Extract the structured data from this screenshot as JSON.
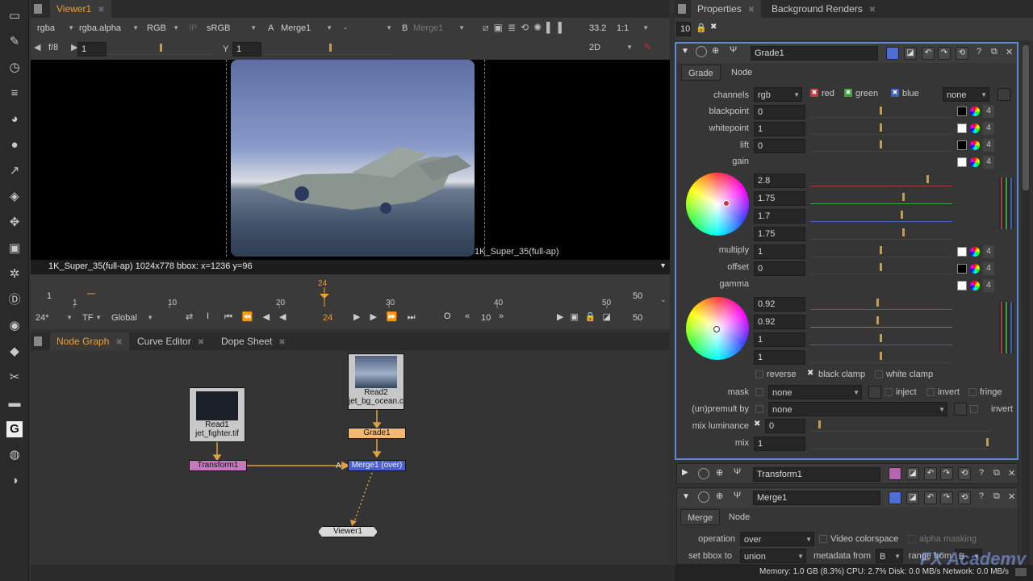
{
  "viewer": {
    "tab": "Viewer1",
    "channels": "rgba",
    "alpha": "rgba.alpha",
    "display": "RGB",
    "ip": "IP",
    "lut": "sRGB",
    "a_label": "A",
    "a_input": "Merge1",
    "ab_sep": "-",
    "b_label": "B",
    "b_input": "Merge1",
    "zoom": "33.2",
    "ratio": "1:1",
    "fstop": "f/8",
    "gain_val": "1",
    "y_label": "Y",
    "gamma_val": "1",
    "view_mode": "2D",
    "format_label": "1K_Super_35(full-ap)",
    "status": "1K_Super_35(full-ap) 1024x778  bbox:  x=1236 y=96"
  },
  "timeline": {
    "start": "1",
    "end": "50",
    "in": "1",
    "out": "50",
    "current": "24",
    "ticks": [
      "10",
      "20",
      "30",
      "40",
      "50"
    ],
    "fps": "24*",
    "tf": "TF",
    "global": "Global",
    "frame": "24",
    "step": "10",
    "end_field": "50",
    "i_btn": "I",
    "o_btn": "O"
  },
  "nodegraph": {
    "tabs": [
      "Node Graph",
      "Curve Editor",
      "Dope Sheet"
    ],
    "nodes": {
      "read1": "Read1",
      "read1_file": "jet_fighter.tif",
      "read2": "Read2",
      "read2_file": "jet_bg_ocean.cin",
      "grade1": "Grade1",
      "transform1": "Transform1",
      "merge1": "Merge1 (over)",
      "viewer1": "Viewer1",
      "a_input": "A"
    }
  },
  "properties": {
    "tabs": [
      "Properties",
      "Background Renders"
    ],
    "max_panels": "10",
    "grade_title": "Grade1",
    "grade_tabs": [
      "Grade",
      "Node"
    ],
    "channels_label": "channels",
    "channels_val": "rgb",
    "red": "red",
    "green": "green",
    "blue": "blue",
    "none_opt": "none",
    "rows": [
      {
        "label": "blackpoint",
        "value": "0"
      },
      {
        "label": "whitepoint",
        "value": "1"
      },
      {
        "label": "lift",
        "value": "0"
      },
      {
        "label": "gain",
        "value": ""
      }
    ],
    "gain_vals": [
      "2.8",
      "1.75",
      "1.7",
      "1.75"
    ],
    "multiply_label": "multiply",
    "multiply": "1",
    "offset_label": "offset",
    "offset": "0",
    "gamma_label": "gamma",
    "gamma_vals": [
      "0.92",
      "0.92",
      "1",
      "1"
    ],
    "four": "4",
    "reverse": "reverse",
    "black_clamp": "black clamp",
    "white_clamp": "white clamp",
    "mask_label": "mask",
    "mask_val": "none",
    "inject": "inject",
    "invert": "invert",
    "fringe": "fringe",
    "premult_label": "(un)premult by",
    "premult_val": "none",
    "invert2": "invert",
    "mix_lum_label": "mix luminance",
    "mix_lum": "0",
    "mix_label": "mix",
    "mix": "1",
    "transform_title": "Transform1",
    "merge_title": "Merge1",
    "merge_tabs": [
      "Merge",
      "Node"
    ],
    "operation_label": "operation",
    "operation_val": "over",
    "video_colorspace": "Video colorspace",
    "alpha_masking": "alpha masking",
    "bbox_label": "set bbox to",
    "bbox_val": "union",
    "metadata_label": "metadata from",
    "metadata_val": "B",
    "range_label": "range from",
    "range_val": "B"
  },
  "status_bar": "Memory: 1.0 GB (8.3%) CPU: 2.7% Disk: 0.0 MB/s Network: 0.0 MB/s",
  "watermark": "FX Academy"
}
